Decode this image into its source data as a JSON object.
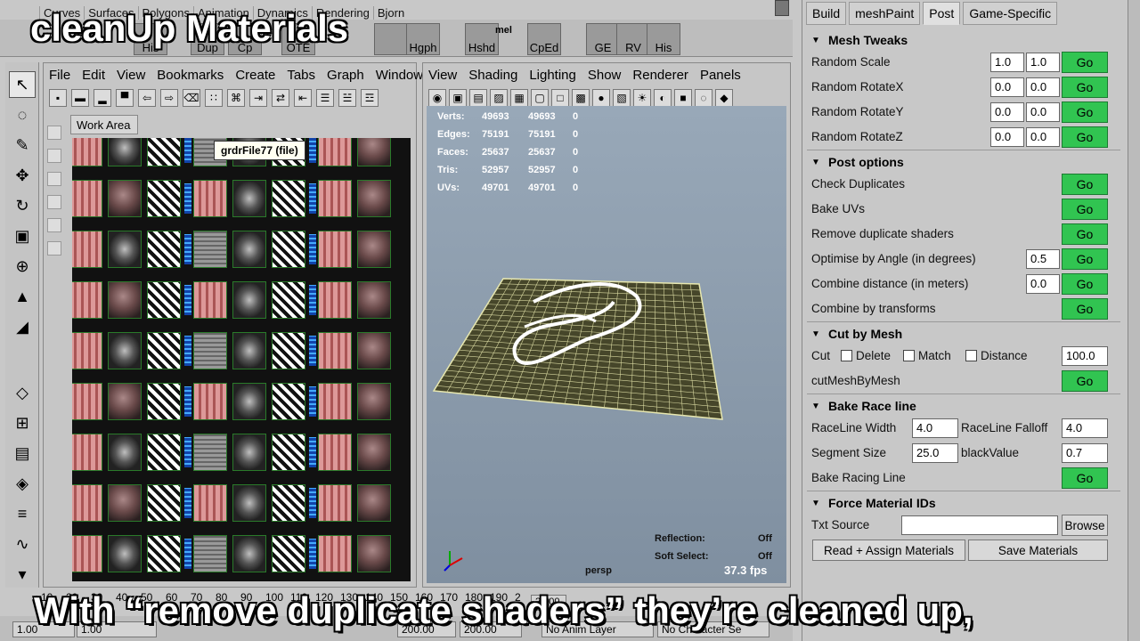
{
  "overlay": {
    "title": "cleanUp Materials",
    "caption": "With “remove duplicate shaders” they’re cleaned up,"
  },
  "shelf": {
    "tabs": [
      "Curves",
      "Surfaces",
      "Polygons",
      "Animation",
      "Dynamics",
      "Rendering",
      "Bjorn"
    ],
    "buttons": [
      "His",
      "Dup",
      "Cp",
      "OTE",
      "",
      "Hgph",
      "Hshd",
      "CpEd",
      "GE",
      "RV",
      "His"
    ],
    "mel_label": "mel"
  },
  "hypershade": {
    "menu": [
      "File",
      "Edit",
      "View",
      "Bookmarks",
      "Create",
      "Tabs",
      "Graph",
      "Window",
      "O"
    ],
    "work_tab": "Work Area",
    "tooltip": "grdrFile77 (file)"
  },
  "viewport": {
    "menu": [
      "View",
      "Shading",
      "Lighting",
      "Show",
      "Renderer",
      "Panels"
    ],
    "stats": [
      {
        "label": "Verts:",
        "a": "49693",
        "b": "49693",
        "c": "0"
      },
      {
        "label": "Edges:",
        "a": "75191",
        "b": "75191",
        "c": "0"
      },
      {
        "label": "Faces:",
        "a": "25637",
        "b": "25637",
        "c": "0"
      },
      {
        "label": "Tris:",
        "a": "52957",
        "b": "52957",
        "c": "0"
      },
      {
        "label": "UVs:",
        "a": "49701",
        "b": "49701",
        "c": "0"
      }
    ],
    "reflection_label": "Reflection:",
    "reflection_value": "Off",
    "soft_select_label": "Soft Select:",
    "soft_select_value": "Off",
    "camera": "persp",
    "fps": "37.3 fps"
  },
  "panel": {
    "tabs": [
      "Build",
      "meshPaint",
      "Post",
      "Game-Specific"
    ],
    "go_label": "Go",
    "mesh_tweaks": {
      "title": "Mesh Tweaks",
      "rows": [
        {
          "label": "Random Scale",
          "v1": "1.0",
          "v2": "1.0"
        },
        {
          "label": "Random RotateX",
          "v1": "0.0",
          "v2": "0.0"
        },
        {
          "label": "Random RotateY",
          "v1": "0.0",
          "v2": "0.0"
        },
        {
          "label": "Random RotateZ",
          "v1": "0.0",
          "v2": "0.0"
        }
      ]
    },
    "post_options": {
      "title": "Post options",
      "rows": [
        {
          "label": "Check Duplicates",
          "value": ""
        },
        {
          "label": "Bake UVs",
          "value": ""
        },
        {
          "label": "Remove duplicate shaders",
          "value": ""
        },
        {
          "label": "Optimise by Angle (in degrees)",
          "value": "0.5"
        },
        {
          "label": "Combine distance (in meters)",
          "value": "0.0"
        },
        {
          "label": "Combine by transforms",
          "value": ""
        }
      ]
    },
    "cut_by_mesh": {
      "title": "Cut by Mesh",
      "cut_label": "Cut",
      "delete_label": "Delete",
      "match_label": "Match",
      "distance_label": "Distance",
      "distance_value": "100.0",
      "cut_mesh_label": "cutMeshByMesh"
    },
    "bake_race_line": {
      "title": "Bake Race line",
      "raceline_width_label": "RaceLine Width",
      "raceline_width_value": "4.0",
      "raceline_falloff_label": "RaceLine Falloff",
      "raceline_falloff_value": "4.0",
      "segment_size_label": "Segment Size",
      "segment_size_value": "25.0",
      "black_value_label": "blackValue",
      "black_value_value": "0.7",
      "bake_label": "Bake Racing Line"
    },
    "force_material_ids": {
      "title": "Force Material IDs",
      "txt_source_label": "Txt Source",
      "txt_source_value": "",
      "browse_label": "Browse",
      "read_assign_label": "Read + Assign Materials",
      "save_label": "Save Materials"
    }
  },
  "timeline": {
    "ticks": [
      "10",
      "20",
      "30",
      "40",
      "50",
      "60",
      "70",
      "80",
      "90",
      "100",
      "110",
      "120",
      "130",
      "140",
      "150",
      "160",
      "170",
      "180",
      "190",
      "2"
    ],
    "current": "23.00",
    "range_start": "1.00",
    "range_start2": "1.00",
    "range_end": "200.00",
    "range_end2": "200.00",
    "anim_layer": "No Anim Layer",
    "character": "No Character Se"
  }
}
